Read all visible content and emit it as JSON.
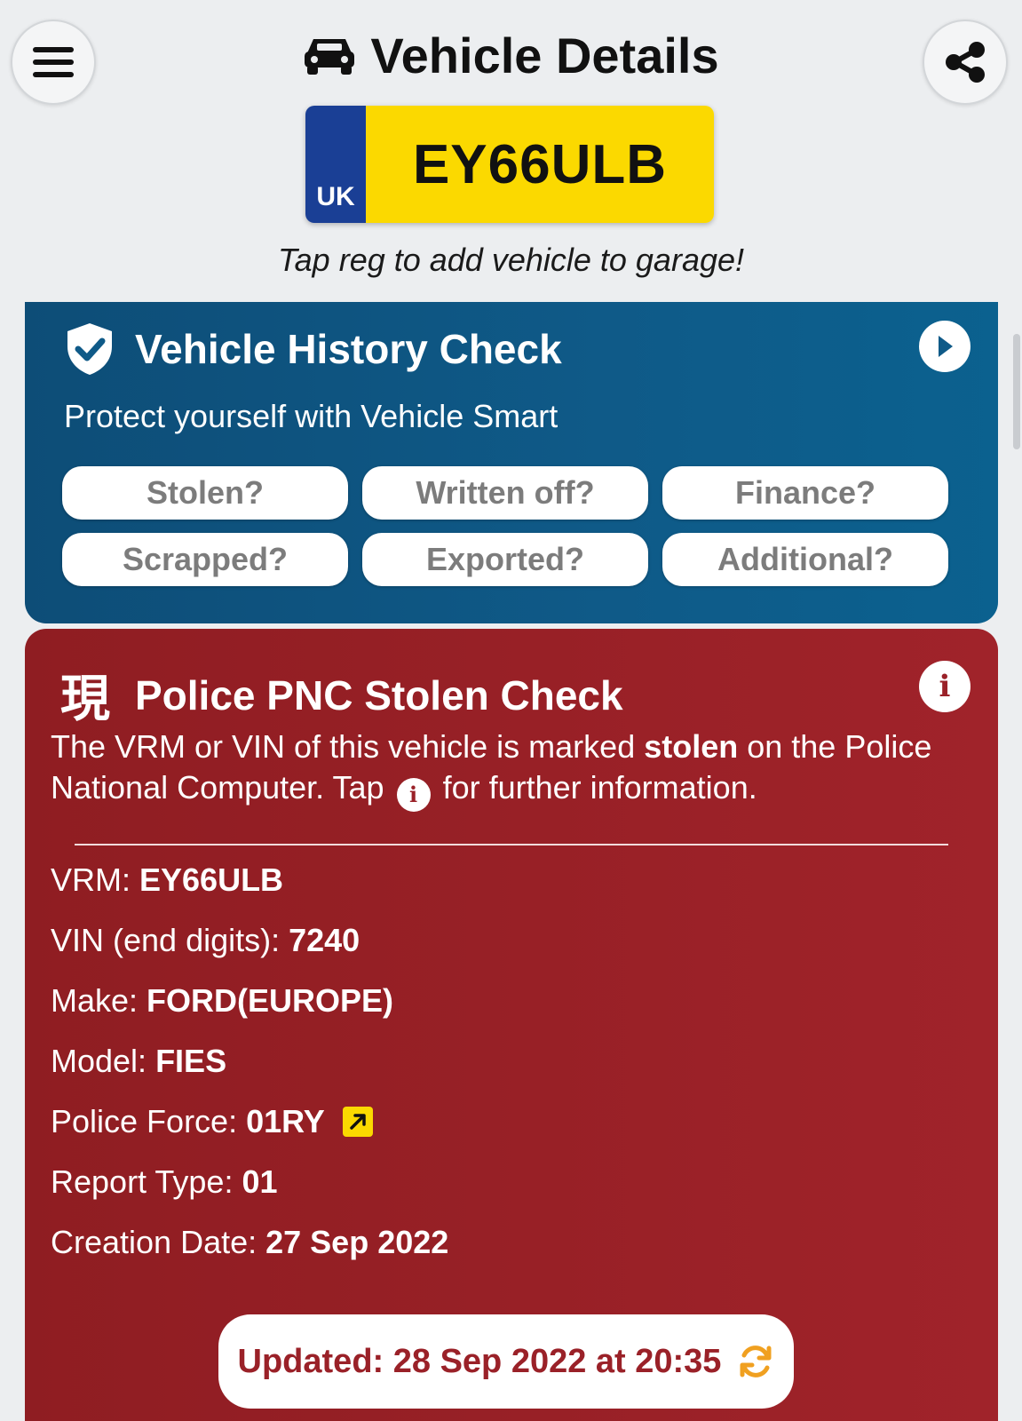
{
  "header": {
    "title": "Vehicle Details"
  },
  "plate": {
    "country": "UK",
    "registration": "EY66ULB"
  },
  "hint": "Tap reg to add vehicle to garage!",
  "history_check": {
    "title": "Vehicle History Check",
    "subtitle": "Protect yourself with Vehicle Smart",
    "buttons": [
      "Stolen?",
      "Written off?",
      "Finance?",
      "Scrapped?",
      "Exported?",
      "Additional?"
    ]
  },
  "stolen_check": {
    "icon_glyph": "現",
    "title": "Police PNC Stolen Check",
    "desc_before": "The VRM or VIN of this vehicle is marked ",
    "desc_bold": "stolen",
    "desc_middle": " on the Police National Computer.  Tap ",
    "desc_after": " for further information.",
    "fields": [
      {
        "label": "VRM:",
        "value": "EY66ULB"
      },
      {
        "label": "VIN (end digits):",
        "value": "7240"
      },
      {
        "label": "Make:",
        "value": "FORD(EUROPE)"
      },
      {
        "label": "Model:",
        "value": "FIES"
      },
      {
        "label": "Police Force:",
        "value": "01RY"
      },
      {
        "label": "Report Type:",
        "value": "01"
      },
      {
        "label": "Creation Date:",
        "value": "27 Sep 2022"
      }
    ],
    "updated": "Updated: 28 Sep 2022 at 20:35"
  },
  "colors": {
    "plate_yellow": "#fbd900",
    "plate_blue": "#1a3f95",
    "history_bg": "#0f5a88",
    "stolen_bg": "#9a2128",
    "refresh_orange": "#f0a020"
  },
  "icons": {
    "menu": "hamburger-menu-icon",
    "share": "share-icon",
    "car": "car-icon",
    "shield": "shield-check-icon",
    "arrow": "play-arrow-icon",
    "info": "info-icon",
    "external_link": "external-link-icon",
    "refresh": "refresh-icon"
  }
}
